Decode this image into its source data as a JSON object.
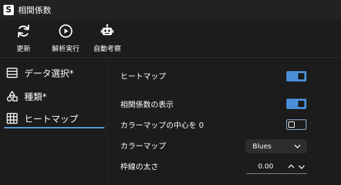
{
  "window": {
    "title": "相関係数",
    "logo_letter": "S"
  },
  "toolbar": {
    "items": [
      {
        "label": "更新",
        "icon": "refresh-icon"
      },
      {
        "label": "解析実行",
        "icon": "play-icon"
      },
      {
        "label": "自動考察",
        "icon": "robot-icon"
      }
    ]
  },
  "sidebar": {
    "items": [
      {
        "label": "データ選択*",
        "icon": "list-icon",
        "selected": false
      },
      {
        "label": "種類*",
        "icon": "shapes-icon",
        "selected": false
      },
      {
        "label": "ヒートマップ",
        "icon": "grid-icon",
        "selected": true
      }
    ]
  },
  "settings": {
    "heatmap": {
      "label": "ヒートマップ",
      "enabled": true
    },
    "show_coef": {
      "label": "相関係数の表示",
      "enabled": true
    },
    "center_zero": {
      "label": "カラーマップの中心を 0",
      "enabled": false
    },
    "colormap": {
      "label": "カラーマップ",
      "value": "Blues"
    },
    "line_width": {
      "label": "枠線の太さ",
      "value": "0.00"
    }
  },
  "colors": {
    "accent": "#4a90d9",
    "background": "#1c1c1c"
  }
}
